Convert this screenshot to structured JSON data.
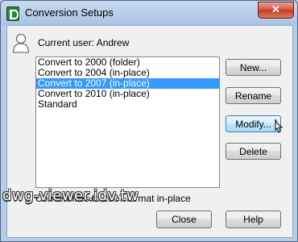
{
  "window": {
    "title": "Conversion Setups",
    "close_label": "✕"
  },
  "current_user": "Current user: Andrew",
  "setups": [
    {
      "label": "Convert to 2000 (folder)",
      "selected": false
    },
    {
      "label": "Convert to 2004 (in-place)",
      "selected": false
    },
    {
      "label": "Convert to 2007 (in-place)",
      "selected": true
    },
    {
      "label": "Convert to 2010 (in-place)",
      "selected": false
    },
    {
      "label": "Standard",
      "selected": false
    }
  ],
  "buttons": {
    "new": "New...",
    "rename": "Rename",
    "modify": "Modify...",
    "delete": "Delete",
    "close": "Close",
    "help": "Help"
  },
  "status": "Convert files to 2007 format in-place",
  "watermark": "dwg-viewer.idv.tw",
  "colors": {
    "selection": "#3399ff",
    "close_button": "#c23a23"
  }
}
